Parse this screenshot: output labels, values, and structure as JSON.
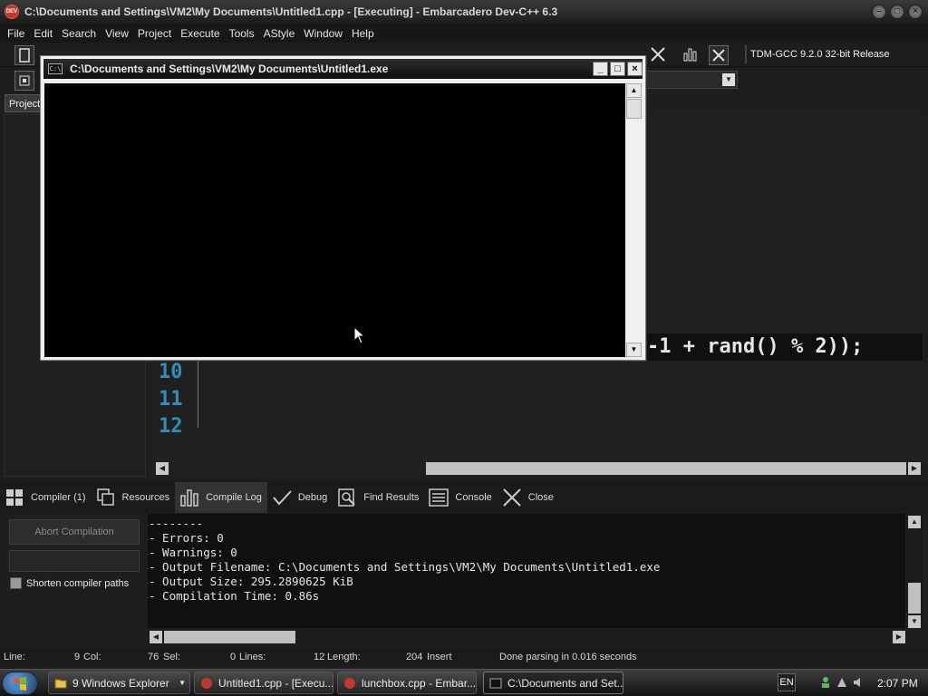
{
  "window": {
    "title": "C:\\Documents and Settings\\VM2\\My Documents\\Untitled1.cpp - [Executing] - Embarcadero Dev-C++ 6.3",
    "icon_text": "DEV"
  },
  "menu": [
    "File",
    "Edit",
    "Search",
    "View",
    "Project",
    "Execute",
    "Tools",
    "AStyle",
    "Window",
    "Help"
  ],
  "toolbar": {
    "compiler": "TDM-GCC 9.2.0 32-bit Release"
  },
  "project_tab": "Project",
  "editor": {
    "visible_code_fragment": "-1 + rand() % 2));",
    "line_numbers": [
      "10",
      "11",
      "12"
    ]
  },
  "bottom_tabs": [
    {
      "label": "Compiler (1)",
      "icon": "grid-icon"
    },
    {
      "label": "Resources",
      "icon": "resources-icon"
    },
    {
      "label": "Compile Log",
      "icon": "chart-icon",
      "active": true
    },
    {
      "label": "Debug",
      "icon": "check-icon"
    },
    {
      "label": "Find Results",
      "icon": "find-icon"
    },
    {
      "label": "Console",
      "icon": "console-icon"
    },
    {
      "label": "Close",
      "icon": "close-icon"
    }
  ],
  "compile_panel": {
    "abort_label": "Abort Compilation",
    "shorten_label": "Shorten compiler paths"
  },
  "compile_log": [
    "--------",
    "- Errors: 0",
    "- Warnings: 0",
    "- Output Filename: C:\\Documents and Settings\\VM2\\My Documents\\Untitled1.exe",
    "- Output Size: 295.2890625 KiB",
    "- Compilation Time: 0.86s"
  ],
  "status": {
    "line_label": "Line:",
    "line_value": "9",
    "col_label": "Col:",
    "col_value": "76",
    "sel_label": "Sel:",
    "sel_value": "0",
    "lines_label": "Lines:",
    "lines_value": "12",
    "length_label": "Length:",
    "length_value": "204",
    "mode": "Insert",
    "message": "Done parsing in 0.016 seconds"
  },
  "console_window": {
    "title": "C:\\Documents and Settings\\VM2\\My Documents\\Untitled1.exe",
    "icon_text": "C:\\"
  },
  "taskbar": {
    "tasks": [
      {
        "label": "9 Windows Explorer",
        "icon": "folder-icon"
      },
      {
        "label": "Untitled1.cpp - [Execu...",
        "icon": "devcpp-icon"
      },
      {
        "label": "lunchbox.cpp - Embar...",
        "icon": "devcpp-icon"
      },
      {
        "label": "C:\\Documents and Set...",
        "icon": "console-icon",
        "active": true
      }
    ],
    "language": "EN",
    "clock": "2:07 PM"
  }
}
